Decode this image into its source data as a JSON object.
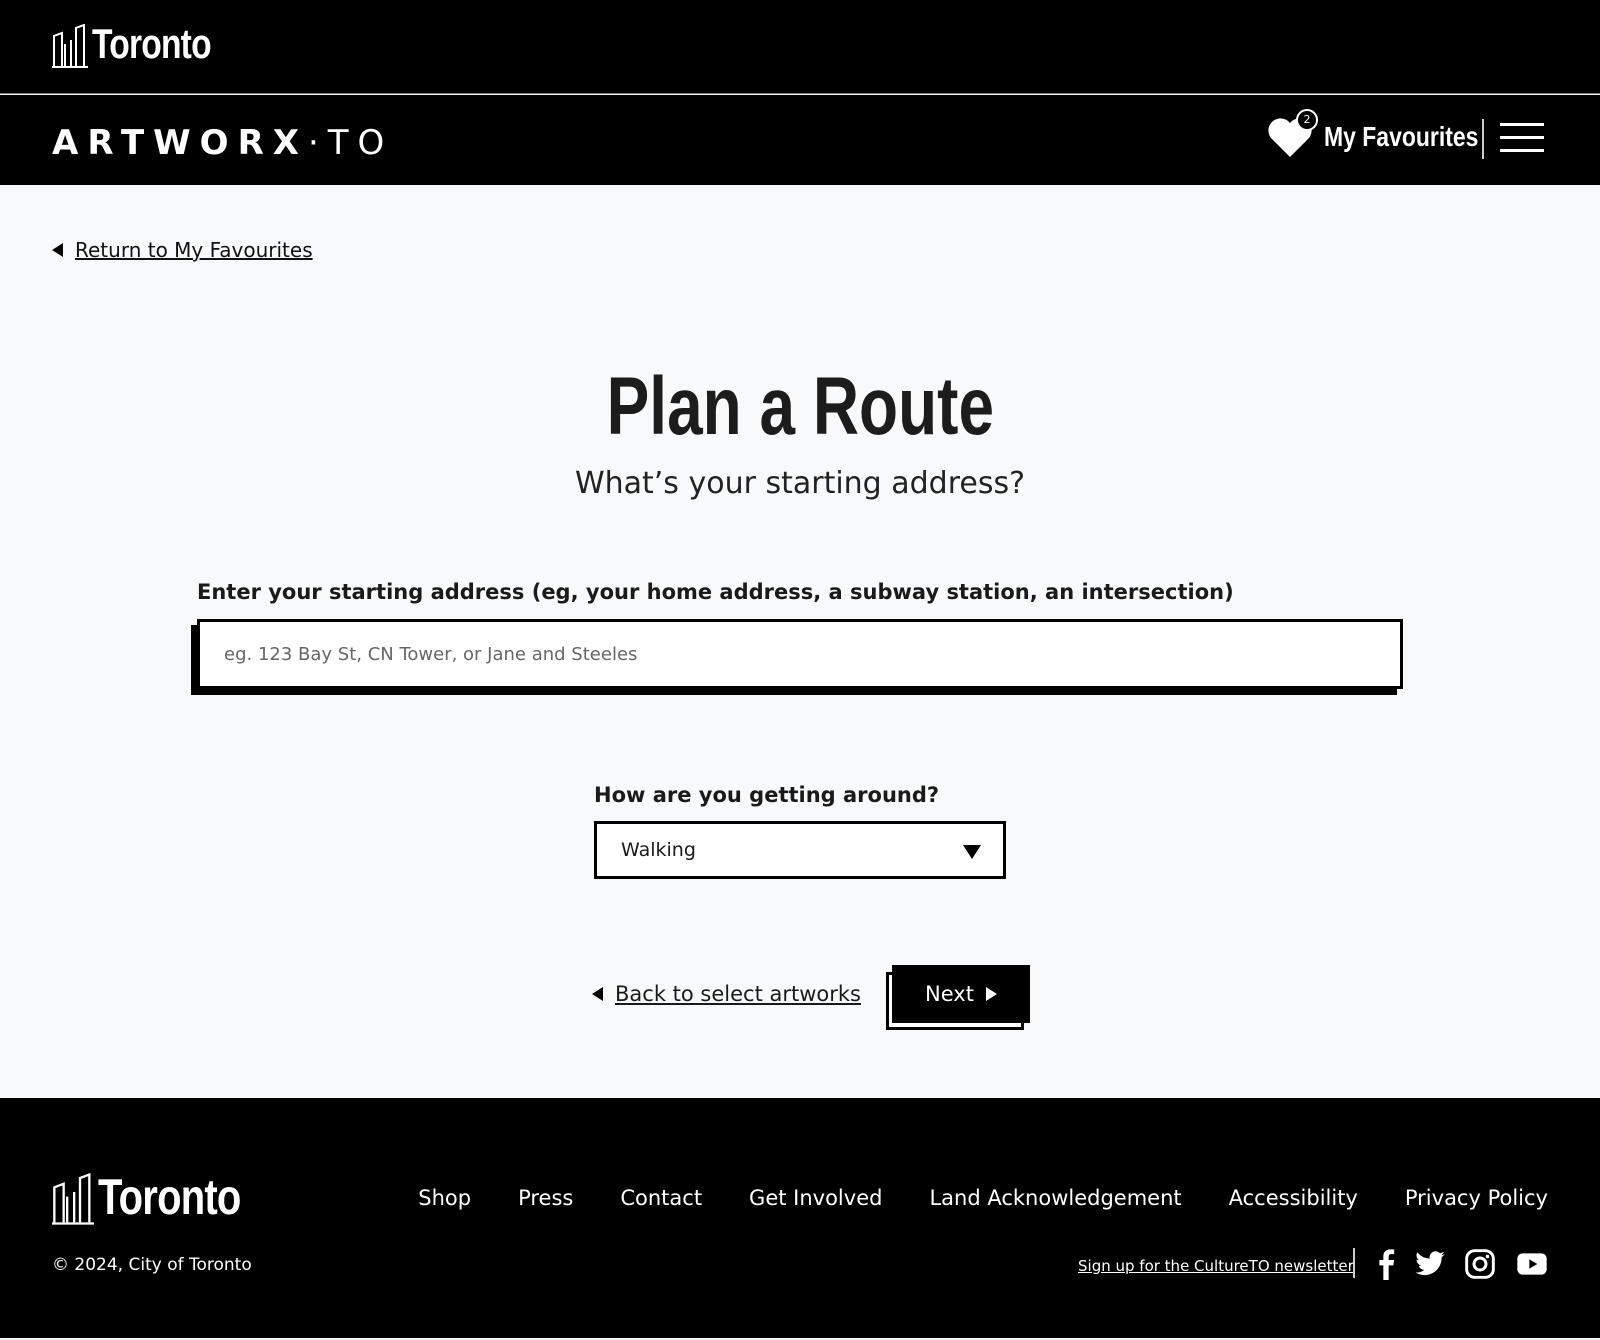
{
  "header": {
    "logo": "Toronto",
    "brand_bold": "ARTWORX",
    "brand_light": "·TO",
    "favourites_label": "My Favourites",
    "favourites_count": "2"
  },
  "main": {
    "return_link": "Return to My Favourites",
    "title": "Plan a Route",
    "subtitle": "What’s your starting address?",
    "address_label": "Enter your starting address (eg, your home address, a subway station, an intersection)",
    "address_value": "",
    "address_placeholder": "eg. 123 Bay St, CN Tower, or Jane and Steeles",
    "mode_label": "How are you getting around?",
    "mode_value": "Walking",
    "back_link": "Back to select artworks",
    "next_label": "Next"
  },
  "footer": {
    "logo": "Toronto",
    "links": [
      "Shop",
      "Press",
      "Contact",
      "Get Involved",
      "Land Acknowledgement",
      "Accessibility",
      "Privacy Policy"
    ],
    "copyright": "© 2024, City of Toronto",
    "newsletter": "Sign up for the CultureTO newsletter",
    "social": [
      "facebook-icon",
      "twitter-icon",
      "instagram-icon",
      "youtube-icon"
    ]
  }
}
